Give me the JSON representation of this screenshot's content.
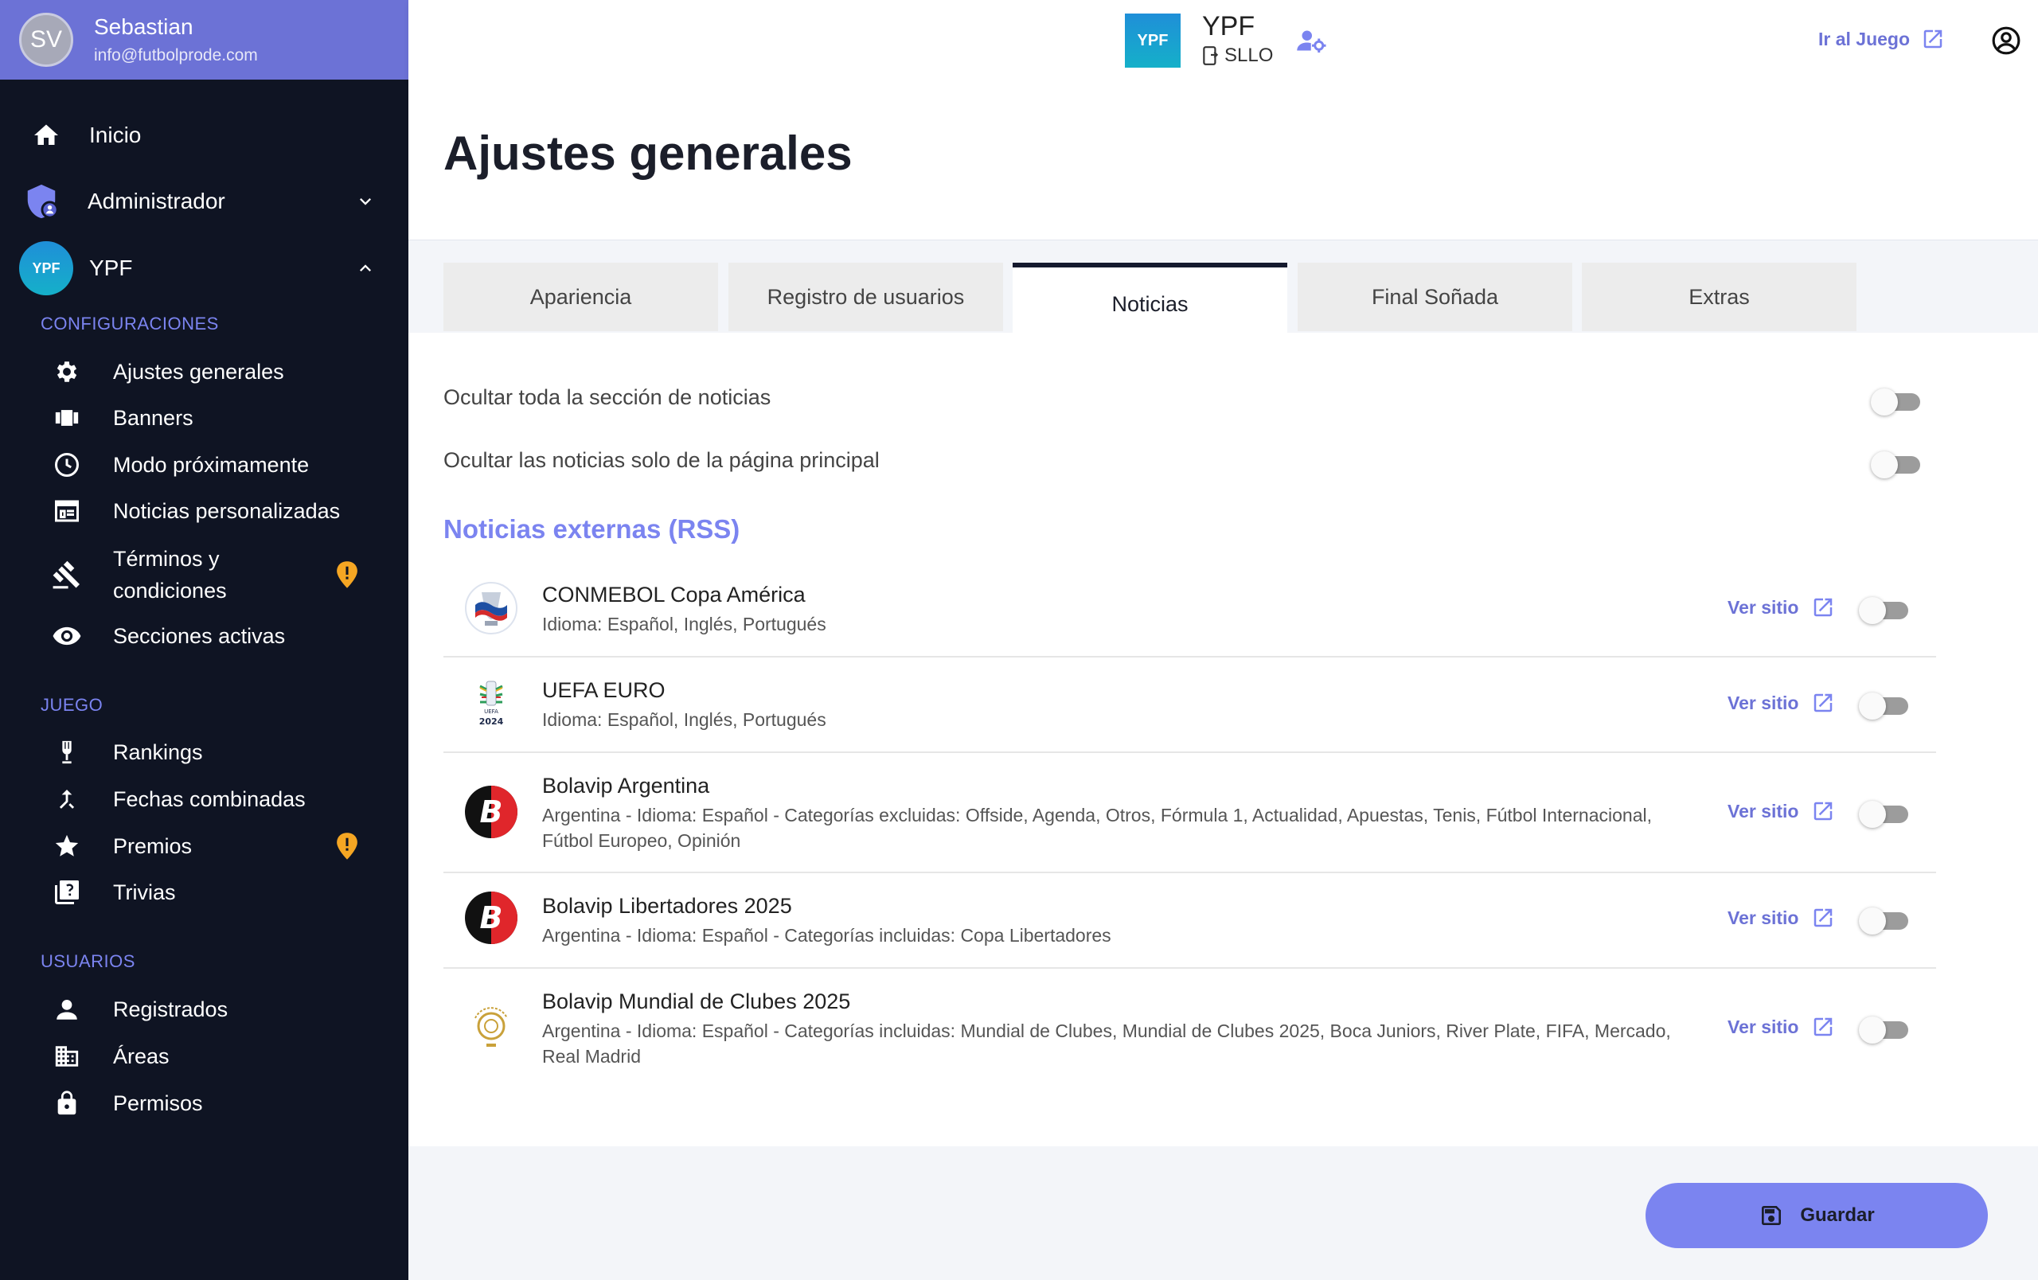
{
  "user": {
    "initials": "SV",
    "name": "Sebastian",
    "email": "info@futbolprode.com"
  },
  "sidebar": {
    "inicio": "Inicio",
    "administrador": "Administrador",
    "org": "YPF",
    "org_badge": "YPF",
    "sections": {
      "config": "CONFIGURACIONES",
      "juego": "JUEGO",
      "usuarios": "USUARIOS"
    },
    "config_items": [
      {
        "label": "Ajustes generales",
        "icon": "gear-icon"
      },
      {
        "label": "Banners",
        "icon": "banner-icon"
      },
      {
        "label": "Modo próximamente",
        "icon": "clock-icon"
      },
      {
        "label": "Noticias personalizadas",
        "icon": "news-icon"
      },
      {
        "label": "Términos y",
        "label2": "condiciones",
        "icon": "gavel-icon",
        "warning": true
      },
      {
        "label": "Secciones activas",
        "icon": "eye-icon"
      }
    ],
    "juego_items": [
      {
        "label": "Rankings",
        "icon": "trophy-icon"
      },
      {
        "label": "Fechas combinadas",
        "icon": "merge-icon"
      },
      {
        "label": "Premios",
        "icon": "star-icon",
        "warning": true
      },
      {
        "label": "Trivias",
        "icon": "quiz-icon"
      }
    ],
    "usuarios_items": [
      {
        "label": "Registrados",
        "icon": "person-icon"
      },
      {
        "label": "Áreas",
        "icon": "building-icon"
      },
      {
        "label": "Permisos",
        "icon": "lock-icon"
      }
    ]
  },
  "topbar": {
    "logo_text": "YPF",
    "org_name": "YPF",
    "org_code": "SLLO",
    "ir_juego": "Ir al Juego"
  },
  "page": {
    "title": "Ajustes generales"
  },
  "tabs": [
    {
      "label": "Apariencia",
      "active": false
    },
    {
      "label": "Registro de usuarios",
      "active": false
    },
    {
      "label": "Noticias",
      "active": true
    },
    {
      "label": "Final Soñada",
      "active": false
    },
    {
      "label": "Extras",
      "active": false
    }
  ],
  "settings": {
    "hide_all": "Ocultar toda la sección de noticias",
    "hide_main": "Ocultar las noticias solo de la página principal",
    "rss_title": "Noticias externas (RSS)"
  },
  "feeds": [
    {
      "name": "CONMEBOL Copa América",
      "desc": "Idioma: Español, Inglés, Portugués",
      "link": "Ver sitio",
      "enabled": false
    },
    {
      "name": "UEFA EURO",
      "desc": "Idioma: Español, Inglés, Portugués",
      "link": "Ver sitio",
      "enabled": false
    },
    {
      "name": "Bolavip Argentina",
      "desc": "Argentina - Idioma: Español - Categorías excluidas: Offside, Agenda, Otros, Fórmula 1, Actualidad, Apuestas, Tenis, Fútbol Internacional, Fútbol Europeo, Opinión",
      "link": "Ver sitio",
      "enabled": false
    },
    {
      "name": "Bolavip Libertadores 2025",
      "desc": "Argentina - Idioma: Español - Categorías incluidas: Copa Libertadores",
      "link": "Ver sitio",
      "enabled": false
    },
    {
      "name": "Bolavip Mundial de Clubes 2025",
      "desc": "Argentina - Idioma: Español - Categorías incluidas: Mundial de Clubes, Mundial de Clubes 2025, Boca Juniors, River Plate, FIFA, Mercado, Real Madrid",
      "link": "Ver sitio",
      "enabled": false
    }
  ],
  "actions": {
    "save": "Guardar"
  },
  "colors": {
    "accent": "#7b84f0",
    "sidebar_bg": "#0f1423",
    "header_bg": "#6c72d6",
    "warning": "#f5a623"
  }
}
